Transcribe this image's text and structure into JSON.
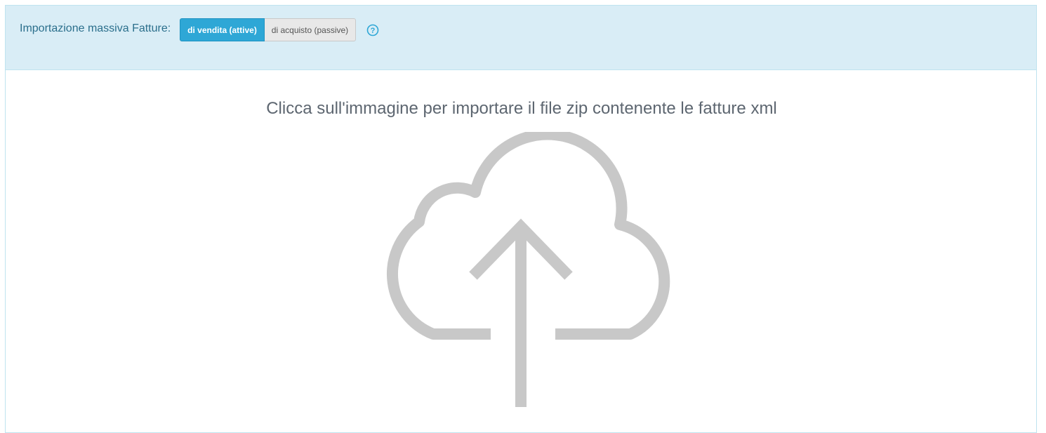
{
  "header": {
    "label": "Importazione massiva Fatture:",
    "buttons": [
      {
        "label": "di vendita (attive)",
        "active": true
      },
      {
        "label": "di acquisto (passive)",
        "active": false
      }
    ],
    "help_icon": "question-circle-icon"
  },
  "main": {
    "instruction": "Clicca sull'immagine per importare il file zip contenente le fatture xml",
    "upload_icon": "cloud-upload-icon"
  },
  "colors": {
    "header_bg": "#d9edf6",
    "accent": "#2ea7d6",
    "icon_gray": "#c8c8c8"
  }
}
